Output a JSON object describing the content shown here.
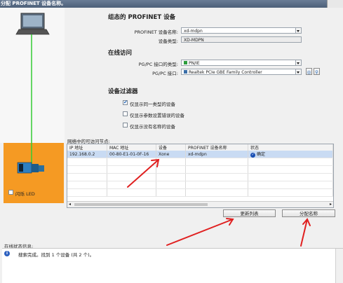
{
  "window": {
    "title": "分配 PROFINET 设备名称。"
  },
  "configured_device": {
    "heading": "组态的 PROFINET 设备",
    "name_label": "PROFINET 设备名称:",
    "name_value": "xd-mdpn",
    "type_label": "设备类型:",
    "type_value": "XD-MDPN"
  },
  "online_access": {
    "heading": "在线访问",
    "iface_type_label": "PG/PC 接口的类型:",
    "iface_type_value": "PN/IE",
    "iface_label": "PG/PC 接口:",
    "iface_value": "Realtek PCIe GBE Family Controller"
  },
  "device_filter": {
    "heading": "设备过滤器",
    "options": [
      {
        "label": "仅显示同一类型的设备",
        "checked": true
      },
      {
        "label": "仅显示参数设置错误的设备",
        "checked": false
      },
      {
        "label": "仅显示没有名称的设备",
        "checked": false
      }
    ]
  },
  "accessible_nodes": {
    "title": "网络中的可访问节点:",
    "columns": [
      "IP 地址",
      "MAC 地址",
      "设备",
      "PROFINET 设备名称",
      "状态"
    ],
    "rows": [
      {
        "ip": "192.168.0.2",
        "mac": "00-80-E1-01-0F-16",
        "device": "Xone",
        "name": "xd-mdpn",
        "status": "确定"
      }
    ]
  },
  "left_panel": {
    "blink_label": "闪烁 LED"
  },
  "buttons": {
    "refresh": "更新列表",
    "assign": "分配名称"
  },
  "status_info": {
    "title": "在线状态信息:",
    "message": "搜索完成。找到 1 个设备 (共 2 个)。"
  },
  "colors": {
    "accent_orange": "#f59a23",
    "link_green": "#33cc33",
    "annotation_red": "#e02020",
    "selection_blue": "#c9dbf3"
  }
}
